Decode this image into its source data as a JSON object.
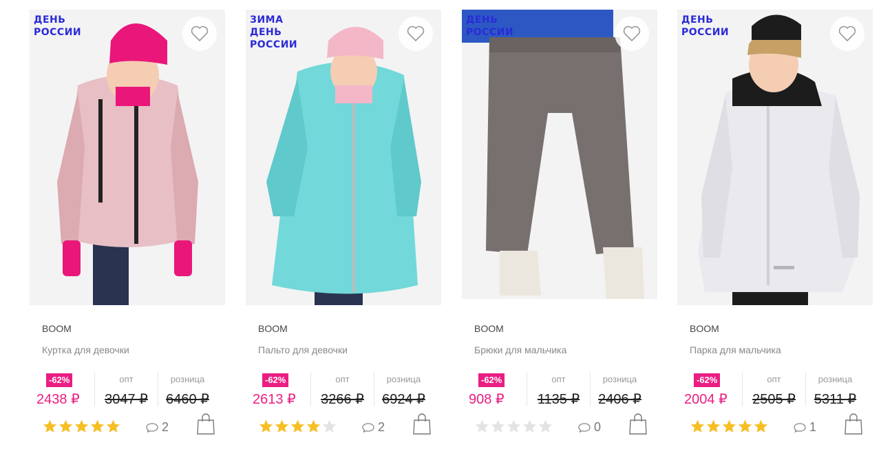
{
  "products": [
    {
      "tags": [
        "ДЕНЬ",
        "РОССИИ"
      ],
      "brand": "BOOM",
      "title": "Куртка для девочки",
      "discount": "-62%",
      "sale_price": "2438 ₽",
      "opt_label": "опт",
      "opt_price": "3047 ₽",
      "retail_label": "розница",
      "retail_price": "6460 ₽",
      "rating": 5,
      "reviews": "2",
      "palette": {
        "main": "#e7bfc4",
        "accent": "#e9177a",
        "bg": "#f2f2f2"
      }
    },
    {
      "tags": [
        "ЗИМА",
        "ДЕНЬ",
        "РОССИИ"
      ],
      "brand": "BOOM",
      "title": "Пальто для девочки",
      "discount": "-62%",
      "sale_price": "2613 ₽",
      "opt_label": "опт",
      "opt_price": "3266 ₽",
      "retail_label": "розница",
      "retail_price": "6924 ₽",
      "rating": 4,
      "reviews": "2",
      "palette": {
        "main": "#72d8d9",
        "accent": "#f3b7c8",
        "bg": "#f2f2f2"
      }
    },
    {
      "tags": [
        "ДЕНЬ",
        "РОССИИ"
      ],
      "brand": "BOOM",
      "title": "Брюки для мальчика",
      "discount": "-62%",
      "sale_price": "908 ₽",
      "opt_label": "опт",
      "opt_price": "1135 ₽",
      "retail_label": "розница",
      "retail_price": "2406 ₽",
      "rating": 0,
      "reviews": "0",
      "palette": {
        "main": "#77706f",
        "accent": "#2d58c4",
        "bg": "#f2f2f2"
      }
    },
    {
      "tags": [
        "ДЕНЬ",
        "РОССИИ"
      ],
      "brand": "BOOM",
      "title": "Парка для мальчика",
      "discount": "-62%",
      "sale_price": "2004 ₽",
      "opt_label": "опт",
      "opt_price": "2505 ₽",
      "retail_label": "розница",
      "retail_price": "5311 ₽",
      "rating": 5,
      "reviews": "1",
      "palette": {
        "main": "#e9e9ee",
        "accent": "#1c1c1c",
        "bg": "#f2f2f2"
      }
    }
  ],
  "colors": {
    "sale": "#ea1e82",
    "tag": "#2a2ad8",
    "star_on": "#f6bf26",
    "star_off": "#e3e3e3"
  },
  "icons": {
    "favorite": "heart-icon",
    "reviews": "comment-icon",
    "cart": "shopping-bag-icon",
    "rating": "star-icon"
  }
}
